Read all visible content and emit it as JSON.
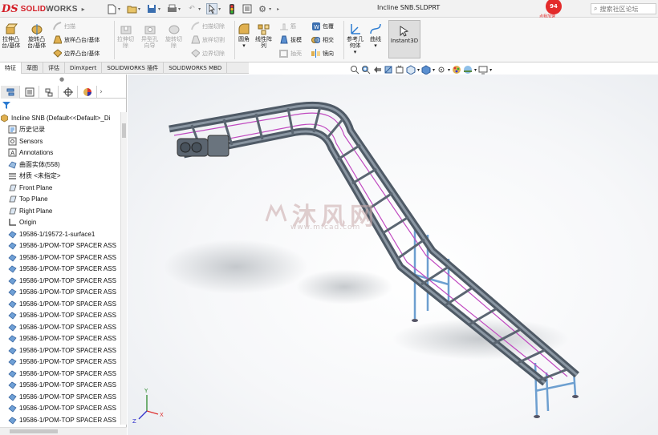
{
  "app": {
    "logo_mark": "DS",
    "brand_red": "SOLID",
    "brand_gray": "WORKS",
    "doc_title": "Incline SNB.SLDPRT"
  },
  "badge": {
    "count": "94",
    "label": "点我加速"
  },
  "search": {
    "placeholder": "搜索社区论坛"
  },
  "ribbon": {
    "extrude": [
      "拉伸凸",
      "台/基体"
    ],
    "revolve": [
      "旋转凸",
      "台/基体"
    ],
    "sweep": "扫描",
    "loft": "放样凸台/基体",
    "boundary": "边界凸台/基体",
    "extrude_cut": [
      "拉伸切",
      "除"
    ],
    "hole_wizard": [
      "异型孔",
      "向导"
    ],
    "revolve_cut": [
      "旋转切",
      "除"
    ],
    "sweep_cut": "扫描切除",
    "loft_cut": "放样切割",
    "boundary_cut": "边界切除",
    "fillet": "圆角",
    "linear_pattern": [
      "线性阵",
      "列"
    ],
    "rib": "筋",
    "draft": "拔模",
    "shell": "抽壳",
    "wrap": "包覆",
    "intersect": "相交",
    "mirror": "镜向",
    "ref_geometry": [
      "参考几",
      "何体"
    ],
    "curves": "曲线",
    "instant3d": "Instant3D"
  },
  "tabs": [
    "特征",
    "草图",
    "评估",
    "DimXpert",
    "SOLIDWORKS 插件",
    "SOLIDWORKS MBD"
  ],
  "tree": {
    "root": "Incline SNB  (Default<<Default>_Di",
    "items": [
      "历史记录",
      "Sensors",
      "Annotations",
      "曲面实体(558)",
      "材质 <未指定>",
      "Front Plane",
      "Top Plane",
      "Right Plane",
      "Origin",
      "19586-1/19572-1-surface1",
      "19586-1/POM-TOP SPACER ASS",
      "19586-1/POM-TOP SPACER ASS",
      "19586-1/POM-TOP SPACER ASS",
      "19586-1/POM-TOP SPACER ASS",
      "19586-1/POM-TOP SPACER ASS",
      "19586-1/POM-TOP SPACER ASS",
      "19586-1/POM-TOP SPACER ASS",
      "19586-1/POM-TOP SPACER ASS",
      "19586-1/POM-TOP SPACER ASS",
      "19586-1/POM-TOP SPACER ASS",
      "19586-1/POM-TOP SPACER ASS",
      "19586-1/POM-TOP SPACER ASS",
      "19586-1/POM-TOP SPACER ASS",
      "19586-1/POM-TOP SPACER ASS",
      "19586-1/POM-TOP SPACER ASS",
      "19586-1/POM-TOP SPACER ASS",
      "19586-1/POM-TOP SPACER ASS"
    ]
  },
  "watermark": {
    "text": "沐风网",
    "url": "www.mfcad.com"
  },
  "triad": {
    "x": "X",
    "y": "Y",
    "z": "Z"
  },
  "colors": {
    "brand": "#d41d26",
    "accent": "#2b7bd1",
    "frame": "#4f5a66",
    "legs": "#6d9fd0"
  }
}
